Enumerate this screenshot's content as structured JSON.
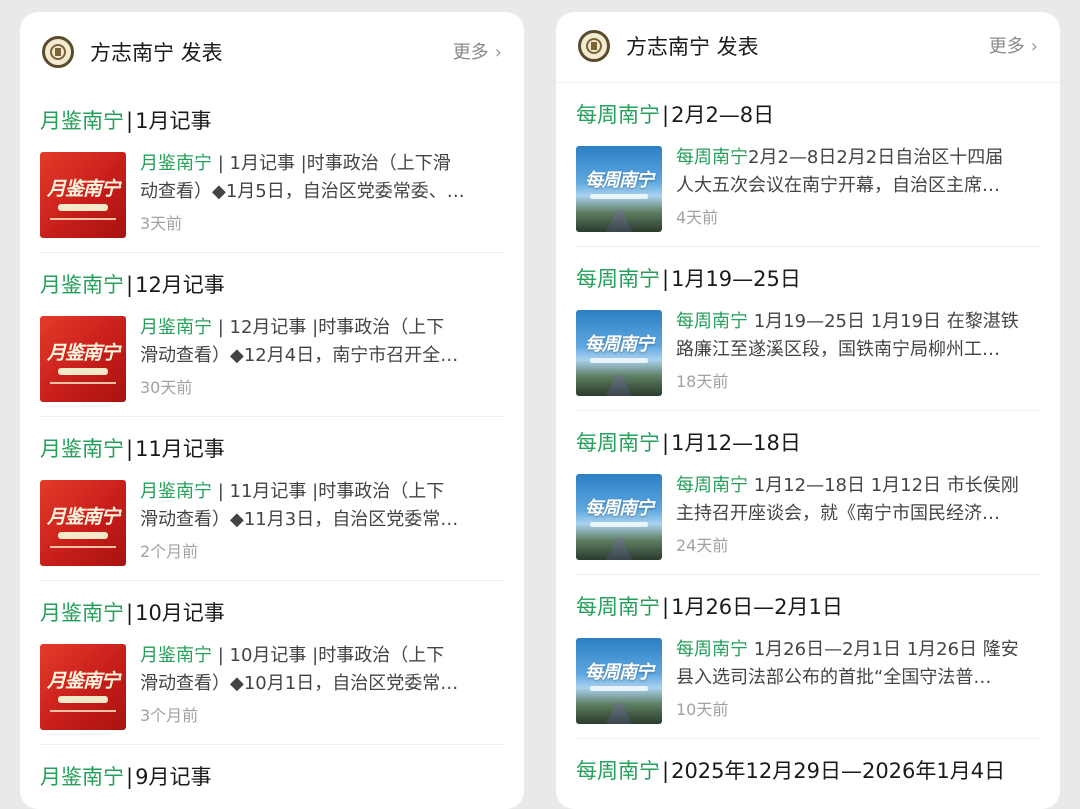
{
  "left": {
    "header": {
      "title": "方志南宁 发表",
      "more": "更多",
      "more_icon": "chevron-right-icon"
    },
    "thumb_label": "月鉴南宁",
    "brand": "月鉴南宁",
    "items": [
      {
        "brand": "月鉴南宁",
        "sep": "|",
        "title": "1月记事",
        "snippet_line1": "月鉴南宁 | 1月记事 |时事政治（上下滑",
        "snippet_line2": "动查看）◆1月5日，自治区党委常委、…",
        "time": "3天前"
      },
      {
        "brand": "月鉴南宁",
        "sep": "|",
        "title": "12月记事",
        "snippet_line1": "月鉴南宁 | 12月记事 |时事政治（上下",
        "snippet_line2": "滑动查看）◆12月4日，南宁市召开全…",
        "time": "30天前"
      },
      {
        "brand": "月鉴南宁",
        "sep": "|",
        "title": "11月记事",
        "snippet_line1": "月鉴南宁 | 11月记事 |时事政治（上下",
        "snippet_line2": "滑动查看）◆11月3日，自治区党委常…",
        "time": "2个月前"
      },
      {
        "brand": "月鉴南宁",
        "sep": "|",
        "title": "10月记事",
        "snippet_line1": "月鉴南宁 | 10月记事 |时事政治（上下",
        "snippet_line2": "滑动查看）◆10月1日，自治区党委常…",
        "time": "3个月前"
      },
      {
        "brand": "月鉴南宁",
        "sep": "|",
        "title": "9月记事"
      }
    ]
  },
  "right": {
    "header": {
      "title": "方志南宁 发表",
      "more": "更多",
      "more_icon": "chevron-right-icon"
    },
    "thumb_label": "每周南宁",
    "items": [
      {
        "brand": "每周南宁",
        "sep": "|",
        "title": "2月2—8日",
        "snippet_line1": "每周南宁2月2—8日2月2日自治区十四届",
        "snippet_line2": "人大五次会议在南宁开幕，自治区主席…",
        "time": "4天前"
      },
      {
        "brand": "每周南宁",
        "sep": "|",
        "title": "1月19—25日",
        "snippet_line1": "每周南宁 1月19—25日 1月19日 在黎湛铁",
        "snippet_line2": "路廉江至遂溪区段，国铁南宁局柳州工…",
        "time": "18天前"
      },
      {
        "brand": "每周南宁",
        "sep": "|",
        "title": "1月12—18日",
        "snippet_line1": "每周南宁 1月12—18日 1月12日 市长侯刚",
        "snippet_line2": "主持召开座谈会，就《南宁市国民经济…",
        "time": "24天前"
      },
      {
        "brand": "每周南宁",
        "sep": "|",
        "title": "1月26日—2月1日",
        "snippet_line1": "每周南宁 1月26日—2月1日 1月26日 隆安",
        "snippet_line2": "县入选司法部公布的首批“全国守法普…",
        "time": "10天前"
      },
      {
        "brand": "每周南宁",
        "sep": "|",
        "title": "2025年12月29日—2026年1月4日"
      }
    ]
  },
  "colors": {
    "brand_green": "#24a05a",
    "muted": "#a2a2a2",
    "thumb_red": "#c81e1a",
    "thumb_blue": "#2c7fc4"
  }
}
